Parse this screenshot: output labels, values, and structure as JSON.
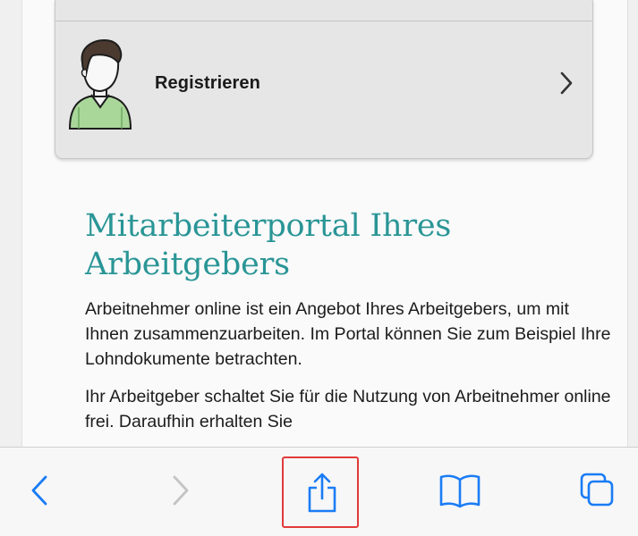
{
  "card": {
    "register_label": "Registrieren"
  },
  "main": {
    "heading": "Mitarbeiterportal Ihres Arbeitgebers",
    "paragraphs": [
      "Arbeitnehmer online ist ein Angebot Ihres Arbeitgebers, um mit Ihnen zusammenzuarbeiten. Im Portal können Sie zum Beispiel Ihre Lohndokumente betrachten.",
      "Ihr Arbeitgeber schaltet Sie für die Nutzung von Arbeitnehmer online frei. Daraufhin erhalten Sie"
    ]
  },
  "toolbar": {
    "icons": [
      "back-icon",
      "forward-icon",
      "share-icon",
      "bookmarks-icon",
      "tabs-icon"
    ],
    "accent_color": "#1a7cf5",
    "disabled_color": "#c4c4c4",
    "highlight_color": "#e23a3a"
  },
  "colors": {
    "heading": "#2a9596",
    "card_bg": "#e6e6e6"
  }
}
